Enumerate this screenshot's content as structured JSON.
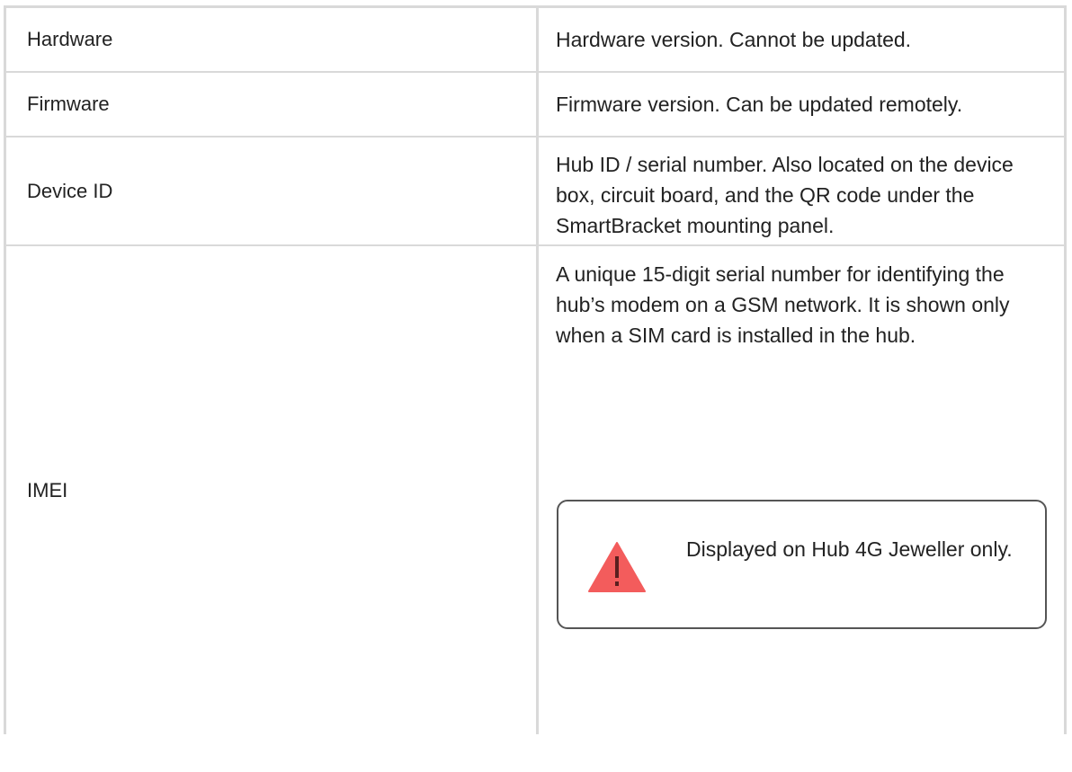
{
  "rows": [
    {
      "name": "Hardware",
      "description": "Hardware version. Cannot be updated."
    },
    {
      "name": "Firmware",
      "description": "Firmware version. Can be updated remotely."
    },
    {
      "name": "Device ID",
      "description": "Hub ID / serial number. Also located on the device box, circuit board, and the QR code under the SmartBracket mounting panel."
    },
    {
      "name": "IMEI",
      "description": "A unique 15-digit serial number for identifying the hub’s modem on a GSM network. It is shown only when a SIM card is installed in the hub."
    }
  ],
  "note": {
    "icon": "warning-triangle-icon",
    "icon_color": "#f35c5c",
    "text": "Displayed on Hub 4G Jeweller only."
  },
  "colors": {
    "border": "#d9d9d9",
    "text": "#222222",
    "note_border": "#555555"
  }
}
